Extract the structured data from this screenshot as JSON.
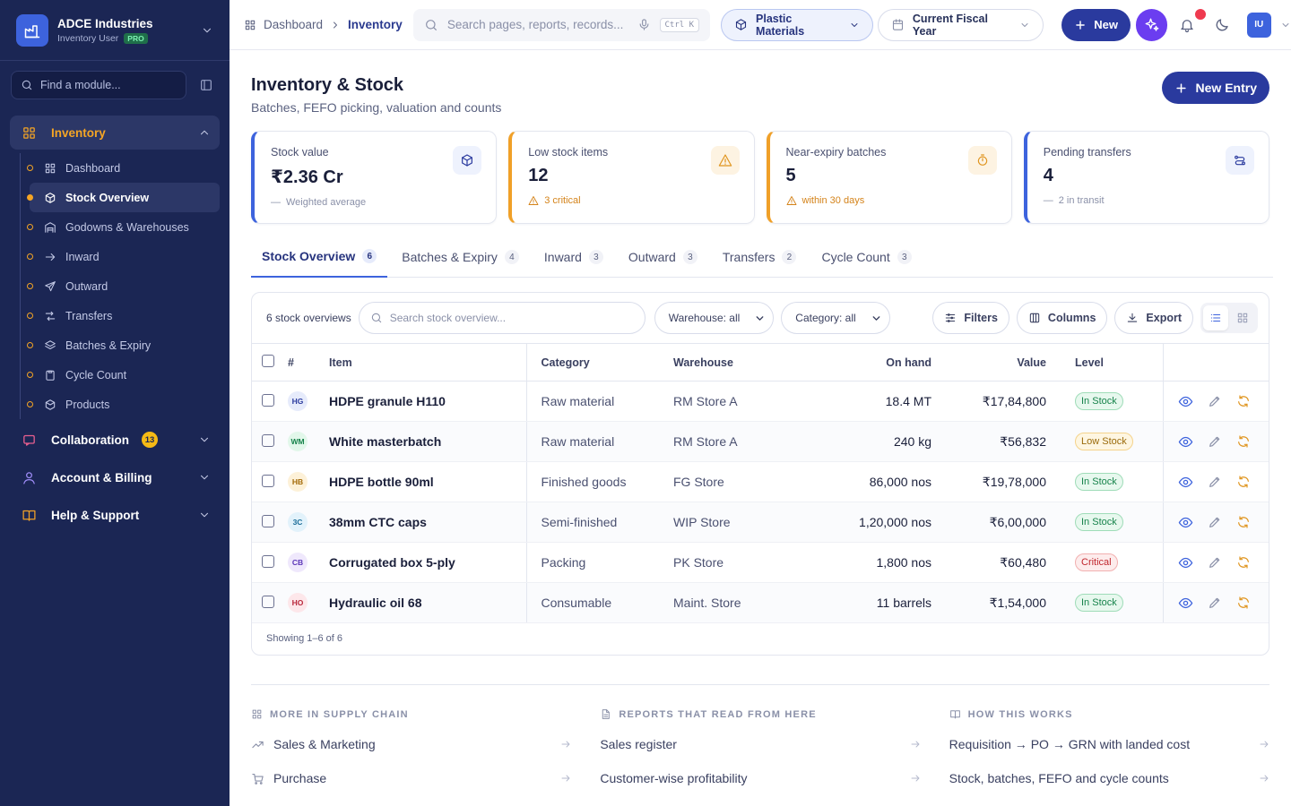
{
  "brand": {
    "name": "ADCE Industries",
    "role": "Inventory User",
    "badge": "PRO"
  },
  "sidebar": {
    "find_placeholder": "Find a module...",
    "inventory": {
      "label": "Inventory",
      "items": [
        {
          "label": "Dashboard"
        },
        {
          "label": "Stock Overview"
        },
        {
          "label": "Godowns & Warehouses"
        },
        {
          "label": "Inward"
        },
        {
          "label": "Outward"
        },
        {
          "label": "Transfers"
        },
        {
          "label": "Batches & Expiry"
        },
        {
          "label": "Cycle Count"
        },
        {
          "label": "Products"
        }
      ]
    },
    "collaboration": {
      "label": "Collaboration",
      "count": "13"
    },
    "account": {
      "label": "Account & Billing"
    },
    "help": {
      "label": "Help & Support"
    }
  },
  "header": {
    "crumb_home": "Dashboard",
    "crumb_current": "Inventory",
    "search_placeholder": "Search pages, reports, records...",
    "shortcut": "Ctrl K",
    "company": "Plastic Materials",
    "period": "Current Fiscal Year",
    "new_label": "New",
    "avatar": "IU"
  },
  "page": {
    "title": "Inventory & Stock",
    "subtitle": "Batches, FEFO picking, valuation and counts",
    "new_entry": "New Entry"
  },
  "kpis": [
    {
      "label": "Stock value",
      "value": "₹2.36 Cr",
      "note": "Weighted average"
    },
    {
      "label": "Low stock items",
      "value": "12",
      "note": "3 critical"
    },
    {
      "label": "Near-expiry batches",
      "value": "5",
      "note": "within 30 days"
    },
    {
      "label": "Pending transfers",
      "value": "4",
      "note": "2 in transit"
    }
  ],
  "tabs": [
    {
      "label": "Stock Overview",
      "count": "6"
    },
    {
      "label": "Batches & Expiry",
      "count": "4"
    },
    {
      "label": "Inward",
      "count": "3"
    },
    {
      "label": "Outward",
      "count": "3"
    },
    {
      "label": "Transfers",
      "count": "2"
    },
    {
      "label": "Cycle Count",
      "count": "3"
    }
  ],
  "toolbar": {
    "count": "6 stock overviews",
    "search_placeholder": "Search stock overview...",
    "warehouse": "Warehouse: all",
    "category": "Category: all",
    "filters": "Filters",
    "columns": "Columns",
    "export": "Export"
  },
  "table": {
    "columns": [
      "#",
      "Item",
      "Category",
      "Warehouse",
      "On hand",
      "Value",
      "Level"
    ],
    "rows": [
      {
        "ini": "HG",
        "item": "HDPE granule H110",
        "category": "Raw material",
        "warehouse": "RM Store A",
        "onhand": "18.4 MT",
        "value": "₹17,84,800",
        "level": "In Stock",
        "level_kind": "in",
        "ini_bg": "#e6ebfb",
        "ini_fg": "#2a3a9e"
      },
      {
        "ini": "WM",
        "item": "White masterbatch",
        "category": "Raw material",
        "warehouse": "RM Store A",
        "onhand": "240 kg",
        "value": "₹56,832",
        "level": "Low Stock",
        "level_kind": "low",
        "ini_bg": "#e2f7ea",
        "ini_fg": "#17834b"
      },
      {
        "ini": "HB",
        "item": "HDPE bottle 90ml",
        "category": "Finished goods",
        "warehouse": "FG Store",
        "onhand": "86,000 nos",
        "value": "₹19,78,000",
        "level": "In Stock",
        "level_kind": "in",
        "ini_bg": "#fdf1d8",
        "ini_fg": "#a36a08"
      },
      {
        "ini": "3C",
        "item": "38mm CTC caps",
        "category": "Semi-finished",
        "warehouse": "WIP Store",
        "onhand": "1,20,000 nos",
        "value": "₹6,00,000",
        "level": "In Stock",
        "level_kind": "in",
        "ini_bg": "#e2f2fb",
        "ini_fg": "#1d6f9a"
      },
      {
        "ini": "CB",
        "item": "Corrugated box 5-ply",
        "category": "Packing",
        "warehouse": "PK Store",
        "onhand": "1,800 nos",
        "value": "₹60,480",
        "level": "Critical",
        "level_kind": "crit",
        "ini_bg": "#efe8fc",
        "ini_fg": "#5b35b8"
      },
      {
        "ini": "HO",
        "item": "Hydraulic oil 68",
        "category": "Consumable",
        "warehouse": "Maint. Store",
        "onhand": "11 barrels",
        "value": "₹1,54,000",
        "level": "In Stock",
        "level_kind": "in",
        "ini_bg": "#fde7ea",
        "ini_fg": "#b8263a"
      }
    ],
    "footer": "Showing 1–6 of 6"
  },
  "more": {
    "supply": {
      "heading": "MORE IN SUPPLY CHAIN",
      "links": [
        "Sales & Marketing",
        "Purchase"
      ]
    },
    "reports": {
      "heading": "REPORTS THAT READ FROM HERE",
      "links": [
        "Sales register",
        "Customer-wise profitability"
      ]
    },
    "how": {
      "heading": "HOW THIS WORKS",
      "links": [
        "Requisition → PO → GRN with landed cost",
        "Stock, batches, FEFO and cycle counts"
      ]
    }
  }
}
